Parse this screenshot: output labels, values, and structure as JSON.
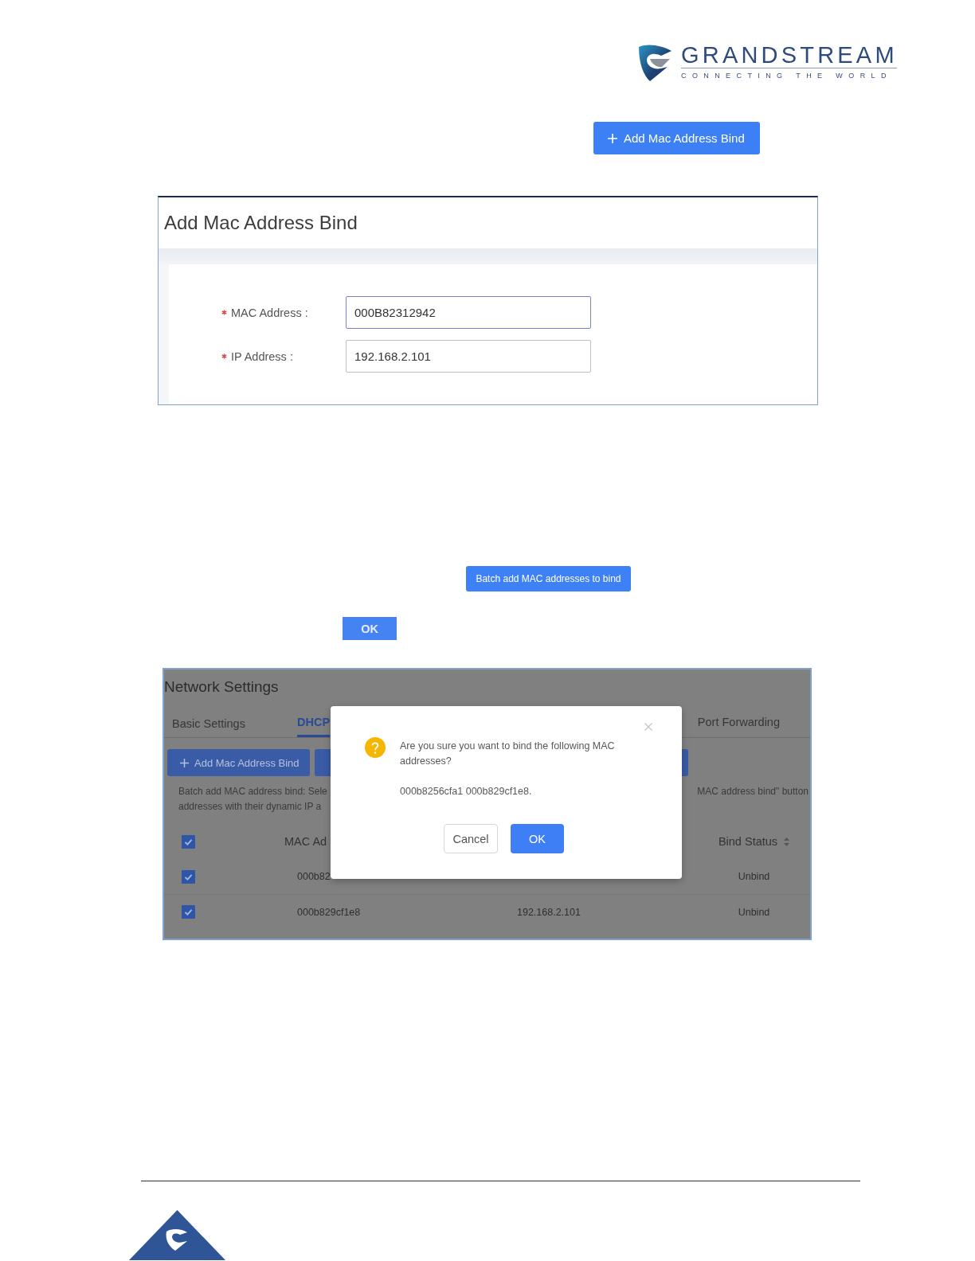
{
  "header": {
    "logo": {
      "name": "GRANDSTREAM",
      "tagline": "CONNECTING THE WORLD"
    }
  },
  "add_button": {
    "label": "Add Mac Address Bind"
  },
  "add_dialog": {
    "title": "Add Mac Address Bind",
    "fields": [
      {
        "label": "MAC Address :",
        "required": true,
        "value": "000B82312942",
        "focused": true
      },
      {
        "label": "IP Address :",
        "required": true,
        "value": "192.168.2.101",
        "focused": false
      }
    ]
  },
  "batch_button": {
    "label": "Batch add MAC addresses to bind"
  },
  "ok_button": {
    "label": "OK"
  },
  "network_settings": {
    "title": "Network Settings",
    "tabs": [
      {
        "label": "Basic Settings",
        "selected": false
      },
      {
        "label": "DHCP",
        "selected": true
      },
      {
        "label": "Port Forwarding",
        "selected": false
      }
    ],
    "toolbar": [
      {
        "label": "Add Mac Address Bind"
      }
    ],
    "help_text": {
      "left": [
        "Batch add MAC address bind: Sele",
        "addresses with their dynamic IP a"
      ],
      "right": "MAC address bind\" button"
    },
    "table": {
      "select_all": true,
      "columns": [
        {
          "label": "MAC Ad",
          "sortable": false
        },
        {
          "label": "Bind Status",
          "sortable": true
        }
      ],
      "rows": [
        {
          "checked": true,
          "mac": "000b82",
          "status": "Unbind"
        },
        {
          "checked": true,
          "mac": "000b829cf1e8",
          "ip": "192.168.2.101",
          "status": "Unbind"
        }
      ]
    },
    "modal": {
      "closable": true,
      "message": "Are you sure you want to bind the following MAC addresses?",
      "detail": "000b8256cfa1 000b829cf1e8.",
      "buttons": [
        {
          "label": "Cancel",
          "kind": "default"
        },
        {
          "label": "OK",
          "kind": "primary"
        }
      ]
    }
  }
}
